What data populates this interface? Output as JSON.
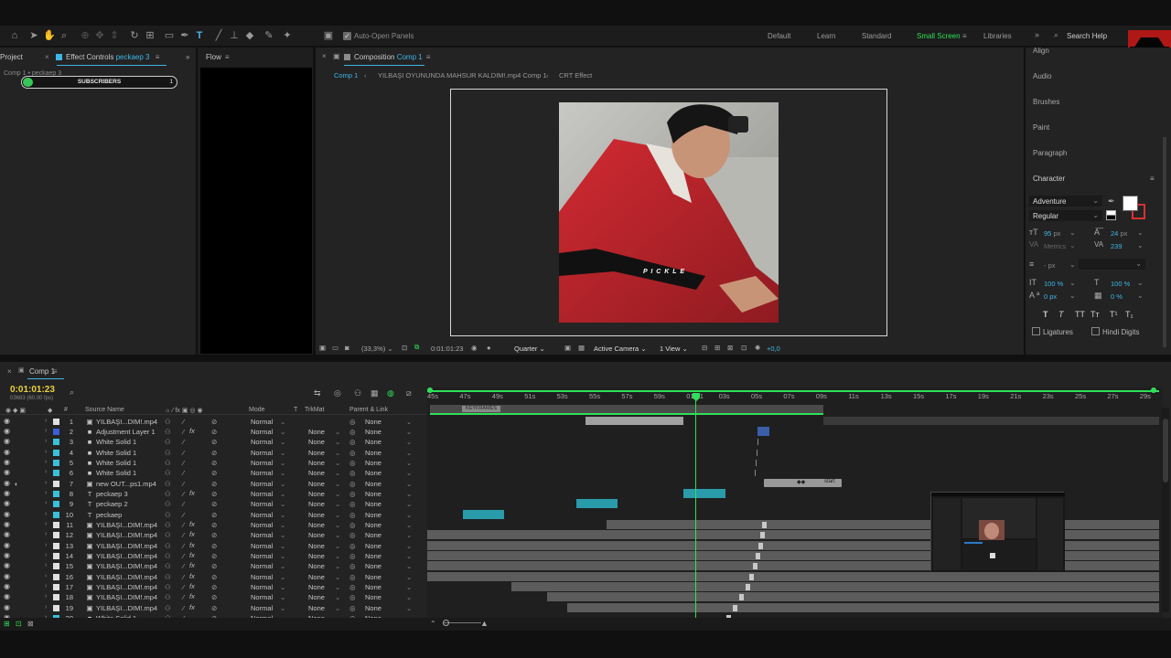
{
  "toolbar": {
    "auto_open_label": "Auto-Open Panels",
    "workspaces": [
      {
        "label": "Default",
        "active": false
      },
      {
        "label": "Learn",
        "active": false
      },
      {
        "label": "Standard",
        "active": false
      },
      {
        "label": "Small Screen",
        "active": true
      },
      {
        "label": "Libraries",
        "active": false
      }
    ],
    "search_placeholder": "Search Help"
  },
  "left_panel": {
    "project_tab": "Project",
    "effect_controls_tab": "Effect Controls",
    "effect_controls_layer": "peckaep 3",
    "breadcrumb": "Comp 1 • peckaep 3",
    "slider_label": "SUBSCRIBERS",
    "slider_value": "1",
    "flow_tab": "Flow"
  },
  "composition": {
    "tab_label": "Composition",
    "tab_comp": "Comp 1",
    "breadcrumbs": [
      "Comp 1",
      "YILBAŞI OYUNUNDA MAHSUR KALDIM!.mp4 Comp 1",
      "CRT Effect"
    ],
    "overlay_text": "P I C K L E",
    "zoom": "(33,3%)",
    "timecode": "0:01:01:23",
    "resolution": "Quarter",
    "camera": "Active Camera",
    "view": "1 View",
    "exposure": "+0,0"
  },
  "right_panel": {
    "items": [
      "Align",
      "Audio",
      "Brushes",
      "Paint",
      "Paragraph"
    ],
    "character_title": "Character",
    "font": "Adventure",
    "style": "Regular",
    "font_size": "95",
    "font_size_unit": "px",
    "leading": "24",
    "leading_unit": "px",
    "kerning": "Metrics",
    "tracking": "239",
    "stroke": "- px",
    "vscale": "100 %",
    "hscale": "100 %",
    "baseline": "0 px",
    "tsume": "0 %",
    "ligatures": "Ligatures",
    "hindi_digits": "Hindi Digits",
    "colors": {
      "fill": "#ffffff",
      "stroke": "#d83030"
    }
  },
  "timeline": {
    "tab": "Comp 1",
    "timecode": "0:01:01:23",
    "fps": "03683 (60.00 fps)",
    "headers": {
      "num": "#",
      "source": "Source Name",
      "mode": "Mode",
      "t": "T",
      "trkmat": "TrkMat",
      "parent": "Parent & Link"
    },
    "ruler": [
      "45s",
      "47s",
      "49s",
      "51s",
      "53s",
      "55s",
      "57s",
      "59s",
      "01:01",
      "03s",
      "05s",
      "07s",
      "09s",
      "11s",
      "13s",
      "15s",
      "17s",
      "19s",
      "21s",
      "23s",
      "25s",
      "27s",
      "29s"
    ],
    "work_area_label": "KEYFRAMES",
    "layers": [
      {
        "num": "1",
        "type": "video",
        "name": "YILBAŞI...DIM!.mp4",
        "label": "#e0e0e0",
        "mode": "Normal",
        "trkmat": "",
        "parent": "None",
        "fx": false
      },
      {
        "num": "2",
        "type": "solid",
        "name": "Adjustment Layer 1",
        "label": "#3a5fd8",
        "mode": "Normal",
        "trkmat": "None",
        "parent": "None",
        "fx": true
      },
      {
        "num": "3",
        "type": "solid",
        "name": "White Solid 1",
        "label": "#3ac0d8",
        "mode": "Normal",
        "trkmat": "None",
        "parent": "None",
        "fx": false
      },
      {
        "num": "4",
        "type": "solid",
        "name": "White Solid 1",
        "label": "#3ac0d8",
        "mode": "Normal",
        "trkmat": "None",
        "parent": "None",
        "fx": false
      },
      {
        "num": "5",
        "type": "solid",
        "name": "White Solid 1",
        "label": "#3ac0d8",
        "mode": "Normal",
        "trkmat": "None",
        "parent": "None",
        "fx": false
      },
      {
        "num": "6",
        "type": "solid",
        "name": "White Solid 1",
        "label": "#3ac0d8",
        "mode": "Normal",
        "trkmat": "None",
        "parent": "None",
        "fx": false
      },
      {
        "num": "7",
        "type": "video",
        "name": "new OUT...ps1.mp4",
        "label": "#e0e0e0",
        "mode": "Normal",
        "trkmat": "None",
        "parent": "None",
        "fx": false
      },
      {
        "num": "8",
        "type": "text",
        "name": "peckaep 3",
        "label": "#3ac0d8",
        "mode": "Normal",
        "trkmat": "None",
        "parent": "None",
        "fx": true
      },
      {
        "num": "9",
        "type": "text",
        "name": "peckaep 2",
        "label": "#3ac0d8",
        "mode": "Normal",
        "trkmat": "None",
        "parent": "None",
        "fx": false
      },
      {
        "num": "10",
        "type": "text",
        "name": "peckaep",
        "label": "#3ac0d8",
        "mode": "Normal",
        "trkmat": "None",
        "parent": "None",
        "fx": false
      },
      {
        "num": "11",
        "type": "video",
        "name": "YILBAŞI...DIM!.mp4",
        "label": "#e0e0e0",
        "mode": "Normal",
        "trkmat": "None",
        "parent": "None",
        "fx": true
      },
      {
        "num": "12",
        "type": "video",
        "name": "YILBAŞI...DIM!.mp4",
        "label": "#e0e0e0",
        "mode": "Normal",
        "trkmat": "None",
        "parent": "None",
        "fx": true
      },
      {
        "num": "13",
        "type": "video",
        "name": "YILBAŞI...DIM!.mp4",
        "label": "#e0e0e0",
        "mode": "Normal",
        "trkmat": "None",
        "parent": "None",
        "fx": true
      },
      {
        "num": "14",
        "type": "video",
        "name": "YILBAŞI...DIM!.mp4",
        "label": "#e0e0e0",
        "mode": "Normal",
        "trkmat": "None",
        "parent": "None",
        "fx": true
      },
      {
        "num": "15",
        "type": "video",
        "name": "YILBAŞI...DIM!.mp4",
        "label": "#e0e0e0",
        "mode": "Normal",
        "trkmat": "None",
        "parent": "None",
        "fx": true
      },
      {
        "num": "16",
        "type": "video",
        "name": "YILBAŞI...DIM!.mp4",
        "label": "#e0e0e0",
        "mode": "Normal",
        "trkmat": "None",
        "parent": "None",
        "fx": true
      },
      {
        "num": "17",
        "type": "video",
        "name": "YILBAŞI...DIM!.mp4",
        "label": "#e0e0e0",
        "mode": "Normal",
        "trkmat": "None",
        "parent": "None",
        "fx": true
      },
      {
        "num": "18",
        "type": "video",
        "name": "YILBAŞI...DIM!.mp4",
        "label": "#e0e0e0",
        "mode": "Normal",
        "trkmat": "None",
        "parent": "None",
        "fx": true
      },
      {
        "num": "19",
        "type": "video",
        "name": "YILBAŞI...DIM!.mp4",
        "label": "#e0e0e0",
        "mode": "Normal",
        "trkmat": "None",
        "parent": "None",
        "fx": true
      },
      {
        "num": "20",
        "type": "solid",
        "name": "White Solid 1",
        "label": "#3ac0d8",
        "mode": "Normal",
        "trkmat": "None",
        "parent": "None",
        "fx": false
      }
    ],
    "marker_label": "start"
  },
  "colors": {
    "accent": "#2fe058",
    "playhead": "#2fe058",
    "blue": "#3fb6e8",
    "cyan_bar": "#2a9bab",
    "panel": "#232323"
  }
}
